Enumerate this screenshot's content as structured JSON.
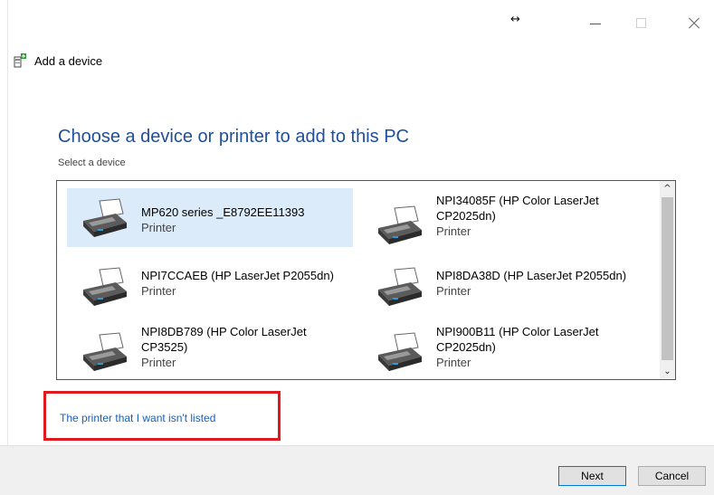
{
  "titlebar": {
    "resize_glyph": "↔"
  },
  "header": {
    "title": "Add a device"
  },
  "main": {
    "heading": "Choose a device or printer to add to this PC",
    "subheading": "Select a device"
  },
  "devices": [
    {
      "name": "MP620 series _E8792EE11393",
      "type": "Printer",
      "selected": true
    },
    {
      "name": "NPI34085F (HP Color LaserJet CP2025dn)",
      "type": "Printer",
      "selected": false
    },
    {
      "name": "NPI7CCAEB (HP LaserJet P2055dn)",
      "type": "Printer",
      "selected": false
    },
    {
      "name": "NPI8DA38D (HP LaserJet P2055dn)",
      "type": "Printer",
      "selected": false
    },
    {
      "name": "NPI8DB789 (HP Color LaserJet CP3525)",
      "type": "Printer",
      "selected": false
    },
    {
      "name": "NPI900B11 (HP Color LaserJet CP2025dn)",
      "type": "Printer",
      "selected": false
    }
  ],
  "scrollbar": {
    "up_glyph": "^",
    "down_glyph": "⌄"
  },
  "link": {
    "label": "The printer that I want isn't listed"
  },
  "footer": {
    "next_label": "Next",
    "cancel_label": "Cancel"
  },
  "colors": {
    "heading": "#1f4e9a",
    "link": "#1a5fb4",
    "selection": "#dbebf9",
    "highlight": "#e0191f"
  }
}
